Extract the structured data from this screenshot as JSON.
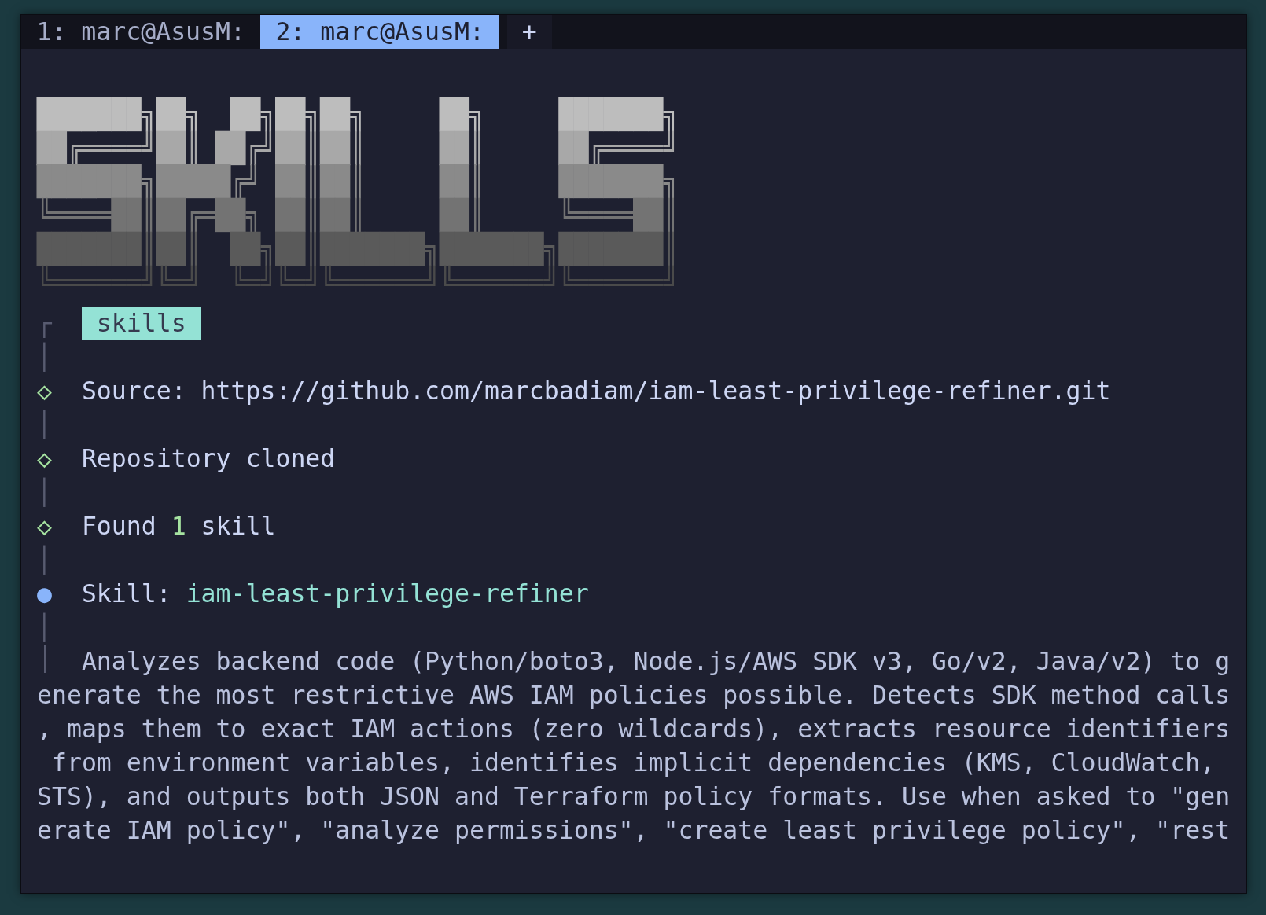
{
  "tabs": [
    {
      "label": "1: marc@AsusM:",
      "selected": false
    },
    {
      "label": "2: marc@AsusM:",
      "selected": true
    }
  ],
  "new_tab": "+",
  "banner": [
    {
      "text": "███████╗██╗  ██╗██╗██╗     ██╗     ███████╗",
      "color": "#bdbdbd"
    },
    {
      "text": "██╔════╝██║ ██╔╝██║██║     ██║     ██╔════╝",
      "color": "#a8a8a8"
    },
    {
      "text": "███████╗█████╔╝ ██║██║     ██║     ███████╗",
      "color": "#8a8a8a"
    },
    {
      "text": "╚════██║██╔═██╗ ██║██║     ██║     ╚════██║",
      "color": "#737373"
    },
    {
      "text": "███████║██║  ██╗██║███████╗███████╗███████║",
      "color": "#5a5a5a"
    },
    {
      "text": "╚══════╝╚═╝  ╚═╝╚═╝╚══════╝╚══════╝╚══════╝",
      "color": "#4a4a4a"
    }
  ],
  "lines": [
    {
      "gutter": "┌",
      "kind": "bar",
      "segments": [
        {
          "text": "skills",
          "kind": "badge"
        }
      ]
    },
    {
      "gutter": "│",
      "kind": "bar"
    },
    {
      "gutter": "◇",
      "kind": "step",
      "segments": [
        {
          "text": "Source: https://github.com/marcbadiam/iam-least-privilege-refiner.git",
          "kind": "plain"
        }
      ]
    },
    {
      "gutter": "│",
      "kind": "bar"
    },
    {
      "gutter": "◇",
      "kind": "step",
      "segments": [
        {
          "text": "Repository cloned",
          "kind": "plain"
        }
      ]
    },
    {
      "gutter": "│",
      "kind": "bar"
    },
    {
      "gutter": "◇",
      "kind": "step",
      "segments": [
        {
          "text": "Found ",
          "kind": "plain"
        },
        {
          "text": "1",
          "kind": "number"
        },
        {
          "text": " skill",
          "kind": "plain"
        }
      ]
    },
    {
      "gutter": "│",
      "kind": "bar"
    },
    {
      "gutter": "●",
      "kind": "current",
      "segments": [
        {
          "text": "Skill: ",
          "kind": "plain"
        },
        {
          "text": "iam-least-privilege-refiner",
          "kind": "name"
        }
      ]
    },
    {
      "gutter": "│",
      "kind": "bar"
    }
  ],
  "description": {
    "text": "Analyzes backend code (Python/boto3, Node.js/AWS SDK v3, Go/v2, Java/v2) to generate the most restrictive AWS IAM policies possible. Detects SDK method calls, maps them to exact IAM actions (zero wildcards), extracts resource identifiers from environment variables, identifies implicit dependencies (KMS, CloudWatch, STS), and outputs both JSON and Terraform policy formats. Use when asked to \"generate IAM policy\", \"analyze permissions\", \"create least privilege policy\", \"rest"
  }
}
